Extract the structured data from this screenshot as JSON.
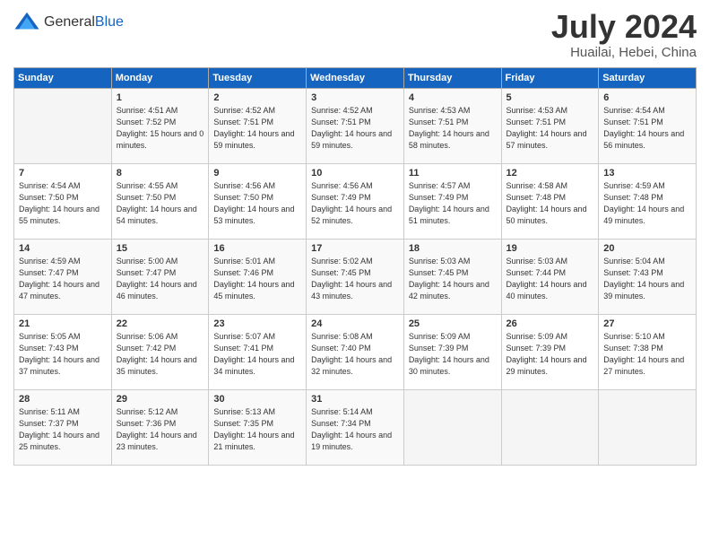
{
  "logo": {
    "general": "General",
    "blue": "Blue"
  },
  "title": "July 2024",
  "location": "Huailai, Hebei, China",
  "days_header": [
    "Sunday",
    "Monday",
    "Tuesday",
    "Wednesday",
    "Thursday",
    "Friday",
    "Saturday"
  ],
  "weeks": [
    [
      {
        "day": "",
        "sunrise": "",
        "sunset": "",
        "daylight": ""
      },
      {
        "day": "1",
        "sunrise": "Sunrise: 4:51 AM",
        "sunset": "Sunset: 7:52 PM",
        "daylight": "Daylight: 15 hours and 0 minutes."
      },
      {
        "day": "2",
        "sunrise": "Sunrise: 4:52 AM",
        "sunset": "Sunset: 7:51 PM",
        "daylight": "Daylight: 14 hours and 59 minutes."
      },
      {
        "day": "3",
        "sunrise": "Sunrise: 4:52 AM",
        "sunset": "Sunset: 7:51 PM",
        "daylight": "Daylight: 14 hours and 59 minutes."
      },
      {
        "day": "4",
        "sunrise": "Sunrise: 4:53 AM",
        "sunset": "Sunset: 7:51 PM",
        "daylight": "Daylight: 14 hours and 58 minutes."
      },
      {
        "day": "5",
        "sunrise": "Sunrise: 4:53 AM",
        "sunset": "Sunset: 7:51 PM",
        "daylight": "Daylight: 14 hours and 57 minutes."
      },
      {
        "day": "6",
        "sunrise": "Sunrise: 4:54 AM",
        "sunset": "Sunset: 7:51 PM",
        "daylight": "Daylight: 14 hours and 56 minutes."
      }
    ],
    [
      {
        "day": "7",
        "sunrise": "Sunrise: 4:54 AM",
        "sunset": "Sunset: 7:50 PM",
        "daylight": "Daylight: 14 hours and 55 minutes."
      },
      {
        "day": "8",
        "sunrise": "Sunrise: 4:55 AM",
        "sunset": "Sunset: 7:50 PM",
        "daylight": "Daylight: 14 hours and 54 minutes."
      },
      {
        "day": "9",
        "sunrise": "Sunrise: 4:56 AM",
        "sunset": "Sunset: 7:50 PM",
        "daylight": "Daylight: 14 hours and 53 minutes."
      },
      {
        "day": "10",
        "sunrise": "Sunrise: 4:56 AM",
        "sunset": "Sunset: 7:49 PM",
        "daylight": "Daylight: 14 hours and 52 minutes."
      },
      {
        "day": "11",
        "sunrise": "Sunrise: 4:57 AM",
        "sunset": "Sunset: 7:49 PM",
        "daylight": "Daylight: 14 hours and 51 minutes."
      },
      {
        "day": "12",
        "sunrise": "Sunrise: 4:58 AM",
        "sunset": "Sunset: 7:48 PM",
        "daylight": "Daylight: 14 hours and 50 minutes."
      },
      {
        "day": "13",
        "sunrise": "Sunrise: 4:59 AM",
        "sunset": "Sunset: 7:48 PM",
        "daylight": "Daylight: 14 hours and 49 minutes."
      }
    ],
    [
      {
        "day": "14",
        "sunrise": "Sunrise: 4:59 AM",
        "sunset": "Sunset: 7:47 PM",
        "daylight": "Daylight: 14 hours and 47 minutes."
      },
      {
        "day": "15",
        "sunrise": "Sunrise: 5:00 AM",
        "sunset": "Sunset: 7:47 PM",
        "daylight": "Daylight: 14 hours and 46 minutes."
      },
      {
        "day": "16",
        "sunrise": "Sunrise: 5:01 AM",
        "sunset": "Sunset: 7:46 PM",
        "daylight": "Daylight: 14 hours and 45 minutes."
      },
      {
        "day": "17",
        "sunrise": "Sunrise: 5:02 AM",
        "sunset": "Sunset: 7:45 PM",
        "daylight": "Daylight: 14 hours and 43 minutes."
      },
      {
        "day": "18",
        "sunrise": "Sunrise: 5:03 AM",
        "sunset": "Sunset: 7:45 PM",
        "daylight": "Daylight: 14 hours and 42 minutes."
      },
      {
        "day": "19",
        "sunrise": "Sunrise: 5:03 AM",
        "sunset": "Sunset: 7:44 PM",
        "daylight": "Daylight: 14 hours and 40 minutes."
      },
      {
        "day": "20",
        "sunrise": "Sunrise: 5:04 AM",
        "sunset": "Sunset: 7:43 PM",
        "daylight": "Daylight: 14 hours and 39 minutes."
      }
    ],
    [
      {
        "day": "21",
        "sunrise": "Sunrise: 5:05 AM",
        "sunset": "Sunset: 7:43 PM",
        "daylight": "Daylight: 14 hours and 37 minutes."
      },
      {
        "day": "22",
        "sunrise": "Sunrise: 5:06 AM",
        "sunset": "Sunset: 7:42 PM",
        "daylight": "Daylight: 14 hours and 35 minutes."
      },
      {
        "day": "23",
        "sunrise": "Sunrise: 5:07 AM",
        "sunset": "Sunset: 7:41 PM",
        "daylight": "Daylight: 14 hours and 34 minutes."
      },
      {
        "day": "24",
        "sunrise": "Sunrise: 5:08 AM",
        "sunset": "Sunset: 7:40 PM",
        "daylight": "Daylight: 14 hours and 32 minutes."
      },
      {
        "day": "25",
        "sunrise": "Sunrise: 5:09 AM",
        "sunset": "Sunset: 7:39 PM",
        "daylight": "Daylight: 14 hours and 30 minutes."
      },
      {
        "day": "26",
        "sunrise": "Sunrise: 5:09 AM",
        "sunset": "Sunset: 7:39 PM",
        "daylight": "Daylight: 14 hours and 29 minutes."
      },
      {
        "day": "27",
        "sunrise": "Sunrise: 5:10 AM",
        "sunset": "Sunset: 7:38 PM",
        "daylight": "Daylight: 14 hours and 27 minutes."
      }
    ],
    [
      {
        "day": "28",
        "sunrise": "Sunrise: 5:11 AM",
        "sunset": "Sunset: 7:37 PM",
        "daylight": "Daylight: 14 hours and 25 minutes."
      },
      {
        "day": "29",
        "sunrise": "Sunrise: 5:12 AM",
        "sunset": "Sunset: 7:36 PM",
        "daylight": "Daylight: 14 hours and 23 minutes."
      },
      {
        "day": "30",
        "sunrise": "Sunrise: 5:13 AM",
        "sunset": "Sunset: 7:35 PM",
        "daylight": "Daylight: 14 hours and 21 minutes."
      },
      {
        "day": "31",
        "sunrise": "Sunrise: 5:14 AM",
        "sunset": "Sunset: 7:34 PM",
        "daylight": "Daylight: 14 hours and 19 minutes."
      },
      {
        "day": "",
        "sunrise": "",
        "sunset": "",
        "daylight": ""
      },
      {
        "day": "",
        "sunrise": "",
        "sunset": "",
        "daylight": ""
      },
      {
        "day": "",
        "sunrise": "",
        "sunset": "",
        "daylight": ""
      }
    ]
  ]
}
